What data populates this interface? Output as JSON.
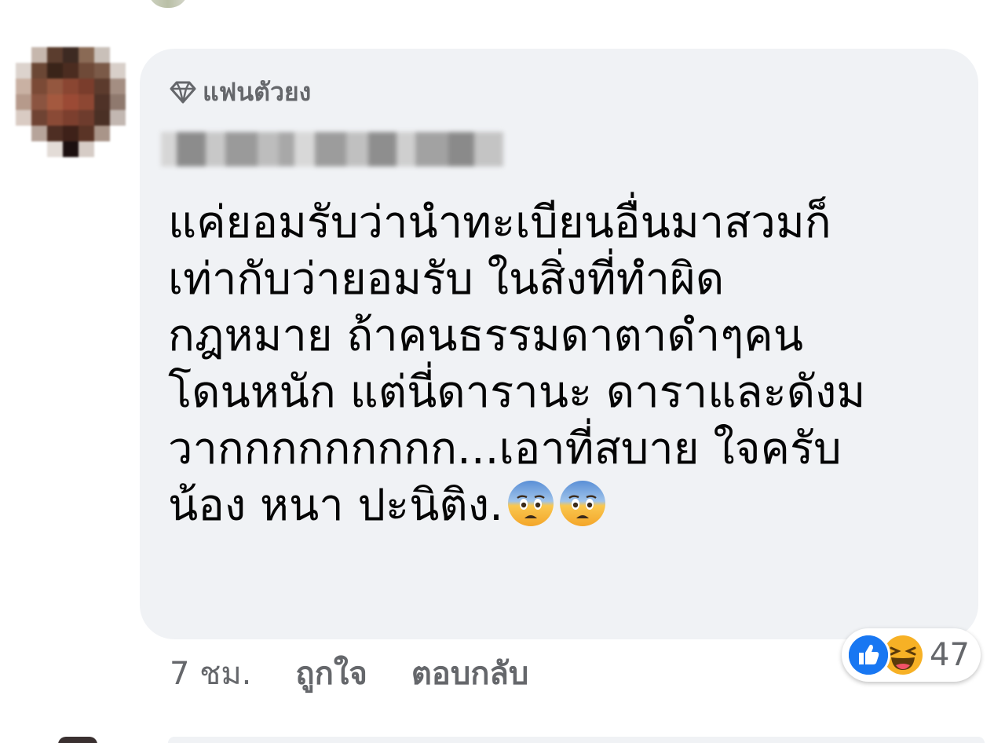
{
  "comment": {
    "badge_icon": "diamond-icon",
    "badge_label": "แฟนตัวยง",
    "author_name": "",
    "text": "แค่ยอมรับว่านำทะเบียนอื่นมาสวมก็\nเท่ากับว่ายอมรับ ในสิ่งที่ทำผิด\nกฎหมาย ถ้าคนธรรมดาตาดำๆคน\nโดนหนัก แต่นี่ดารานะ ดาราและดังม\nวากกกกกกกกก...เอาที่สบาย ใจครับ\nน้อง หนา ปะนิติง.",
    "emojis": [
      "fearful-face-emoji",
      "fearful-face-emoji"
    ]
  },
  "actions": {
    "time": "7 ชม.",
    "like_label": "ถูกใจ",
    "reply_label": "ตอบกลับ"
  },
  "reactions": {
    "icons": [
      "like-reaction-icon",
      "haha-reaction-icon"
    ],
    "count": "47"
  },
  "colors": {
    "bubble": "#f0f2f5",
    "secondary_text": "#65676b",
    "primary_text": "#050505",
    "like_blue": "#1877f2",
    "haha_yellow": "#f7b125"
  }
}
